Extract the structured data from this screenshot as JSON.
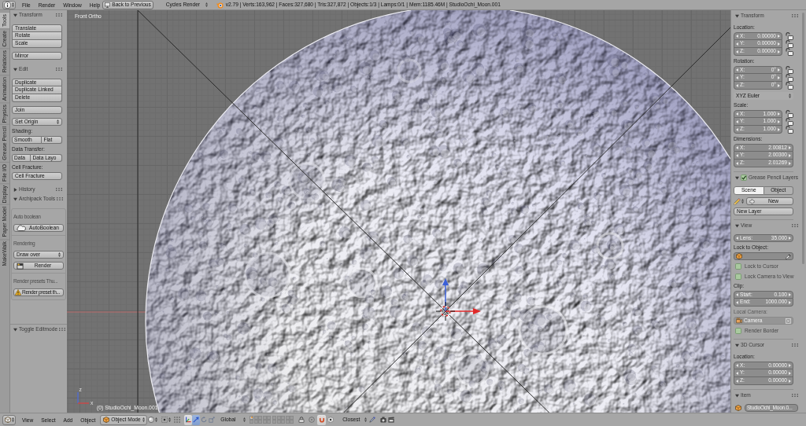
{
  "top_bar": {
    "menus": [
      "File",
      "Render",
      "Window",
      "Help"
    ],
    "back_button": "Back to Previous",
    "engine": "Cycles Render",
    "stats": "v2.79 | Verts:163,962 | Faces:327,680 | Tris:327,872 | Objects:1/3 | Lamps:0/1 | Mem:1185.46M | StudioOchi_Moon.001"
  },
  "left_tabs": [
    {
      "label": "Tools",
      "selected": true
    },
    {
      "label": "Create",
      "selected": false
    },
    {
      "label": "Relations",
      "selected": false
    },
    {
      "label": "Animation",
      "selected": false
    },
    {
      "label": "Physics",
      "selected": false
    },
    {
      "label": "Grease Pencil",
      "selected": false
    },
    {
      "label": "File I/O",
      "selected": false
    },
    {
      "label": "Display",
      "selected": false
    },
    {
      "label": "Paper Model",
      "selected": false
    },
    {
      "label": "MakeWalk",
      "selected": false
    }
  ],
  "left_panel": {
    "panels": [
      {
        "title": "Transform",
        "expanded": true,
        "items": [
          {
            "kind": "column",
            "buttons": [
              "Translate",
              "Rotate",
              "Scale"
            ]
          },
          {
            "kind": "button",
            "label": "Mirror"
          }
        ]
      },
      {
        "title": "Edit",
        "expanded": true,
        "items": [
          {
            "kind": "column",
            "buttons": [
              "Duplicate",
              "Duplicate Linked",
              "Delete"
            ]
          },
          {
            "kind": "button",
            "label": "Join"
          },
          {
            "kind": "dropdown",
            "label": "Set Origin"
          },
          {
            "kind": "label",
            "text": "Shading:"
          },
          {
            "kind": "row",
            "buttons": [
              "Smooth",
              "Flat"
            ]
          },
          {
            "kind": "label",
            "text": "Data Transfer:"
          },
          {
            "kind": "row",
            "buttons": [
              "Data",
              "Data Layo"
            ]
          },
          {
            "kind": "label",
            "text": "Cell Fracture:"
          },
          {
            "kind": "button",
            "label": "Cell Fracture"
          }
        ]
      },
      {
        "title": "History",
        "expanded": false
      },
      {
        "title": "Archipack Tools",
        "expanded": true,
        "sections": [
          {
            "items": [
              {
                "kind": "caption",
                "text": "Auto boolean"
              },
              {
                "kind": "boolean",
                "label": "AutoBoolean"
              }
            ]
          },
          {
            "items": [
              {
                "kind": "caption",
                "text": "Rendering"
              },
              {
                "kind": "dropdown",
                "label": "Draw over"
              },
              {
                "kind": "render",
                "label": "Render"
              }
            ]
          },
          {
            "items": [
              {
                "kind": "caption",
                "text": "Render presets Thu..."
              },
              {
                "kind": "warning",
                "label": "Render preset th..."
              }
            ]
          }
        ]
      }
    ],
    "operator_panel": {
      "title": "Toggle Editmode",
      "expanded": true
    }
  },
  "viewport": {
    "view_label": "Front Ortho",
    "axis_labels": [
      "z",
      "x"
    ],
    "object_label": "(0) StudioOchi_Moon.001"
  },
  "right_panel": {
    "panels": [
      {
        "title": "Transform",
        "expanded": true,
        "items": [
          {
            "kind": "label",
            "text": "Location:"
          },
          {
            "kind": "vector",
            "fields": [
              {
                "name": "X:",
                "value": "0.00000",
                "locked": false
              },
              {
                "name": "Y:",
                "value": "0.00000",
                "locked": false
              },
              {
                "name": "Z:",
                "value": "0.00000",
                "locked": false
              }
            ]
          },
          {
            "kind": "label",
            "text": "Rotation:"
          },
          {
            "kind": "vector",
            "fields": [
              {
                "name": "X:",
                "value": "0°",
                "locked": false
              },
              {
                "name": "Y:",
                "value": "0°",
                "locked": false
              },
              {
                "name": "Z:",
                "value": "0°",
                "locked": false
              }
            ]
          },
          {
            "kind": "menu",
            "label": "XYZ Euler"
          },
          {
            "kind": "label",
            "text": "Scale:"
          },
          {
            "kind": "vector",
            "fields": [
              {
                "name": "X:",
                "value": "1.000",
                "locked": false
              },
              {
                "name": "Y:",
                "value": "1.000",
                "locked": false
              },
              {
                "name": "Z:",
                "value": "1.000",
                "locked": false
              }
            ]
          },
          {
            "kind": "label",
            "text": "Dimensions:"
          },
          {
            "kind": "vector",
            "fields": [
              {
                "name": "X:",
                "value": "2.00812"
              },
              {
                "name": "Y:",
                "value": "2.00300"
              },
              {
                "name": "Z:",
                "value": "2.01269"
              }
            ]
          }
        ]
      },
      {
        "title": "Grease Pencil Layers",
        "expanded": true,
        "checked": true,
        "items": [
          {
            "kind": "tabs",
            "tabs": [
              {
                "label": "Scene",
                "selected": true
              },
              {
                "label": "Object",
                "selected": false
              }
            ]
          },
          {
            "kind": "newlayer",
            "label": "New"
          },
          {
            "kind": "button",
            "label": "New Layer"
          }
        ]
      },
      {
        "title": "View",
        "expanded": true,
        "items": [
          {
            "kind": "vector",
            "fields": [
              {
                "name": "Lens:",
                "value": "35.000"
              }
            ]
          },
          {
            "kind": "label",
            "text": "Lock to Object:"
          },
          {
            "kind": "object",
            "disabled": false
          },
          {
            "kind": "checkbox",
            "label": "Lock to Cursor",
            "checked": false
          },
          {
            "kind": "checkbox",
            "label": "Lock Camera to View",
            "checked": false
          },
          {
            "kind": "label",
            "text": "Clip:"
          },
          {
            "kind": "vector",
            "fields": [
              {
                "name": "Start:",
                "value": "0.100"
              },
              {
                "name": "End:",
                "value": "1000.000"
              }
            ]
          },
          {
            "kind": "label",
            "text": "Local Camera:",
            "disabled": true
          },
          {
            "kind": "object",
            "value": "Camera",
            "disabled": true
          },
          {
            "kind": "checkbox",
            "label": "Render Border",
            "checked": false
          }
        ]
      },
      {
        "title": "3D Cursor",
        "expanded": true,
        "items": [
          {
            "kind": "label",
            "text": "Location:"
          },
          {
            "kind": "vector",
            "fields": [
              {
                "name": "X:",
                "value": "0.00000"
              },
              {
                "name": "Y:",
                "value": "0.00000"
              },
              {
                "name": "Z:",
                "value": "0.00000"
              }
            ]
          }
        ]
      },
      {
        "title": "Item",
        "expanded": true,
        "items": [
          {
            "kind": "name",
            "value": "StudioOchi_Moon.0..."
          }
        ]
      }
    ]
  },
  "bottom_bar": {
    "menus": [
      "View",
      "Select",
      "Add",
      "Object"
    ],
    "mode": "Object Mode",
    "manipulators": [
      {
        "kind": "toggle",
        "on": true
      },
      {
        "kind": "translate",
        "on": true
      },
      {
        "kind": "rotate",
        "on": false
      },
      {
        "kind": "scale",
        "on": false
      }
    ],
    "orientation": "Global",
    "layers": [
      {
        "selected": true,
        "used": true
      },
      {
        "selected": false,
        "used": false
      },
      {
        "selected": false,
        "used": false
      },
      {
        "selected": false,
        "used": false
      },
      {
        "selected": false,
        "used": false
      },
      {
        "selected": false,
        "used": false
      },
      {
        "selected": false,
        "used": false
      },
      {
        "selected": false,
        "used": false
      },
      {
        "selected": false,
        "used": false
      },
      {
        "selected": false,
        "used": false
      },
      {
        "selected": false,
        "used": false
      },
      {
        "selected": false,
        "used": false
      },
      {
        "selected": false,
        "used": false
      },
      {
        "selected": false,
        "used": false
      },
      {
        "selected": false,
        "used": false
      },
      {
        "selected": false,
        "used": false
      },
      {
        "selected": false,
        "used": false
      },
      {
        "selected": false,
        "used": false
      },
      {
        "selected": false,
        "used": false
      },
      {
        "selected": false,
        "used": false
      }
    ],
    "snapping": [
      {
        "kind": "proportional",
        "on": false
      },
      {
        "kind": "magnet",
        "on": true
      }
    ],
    "snap_target": "Closest"
  }
}
